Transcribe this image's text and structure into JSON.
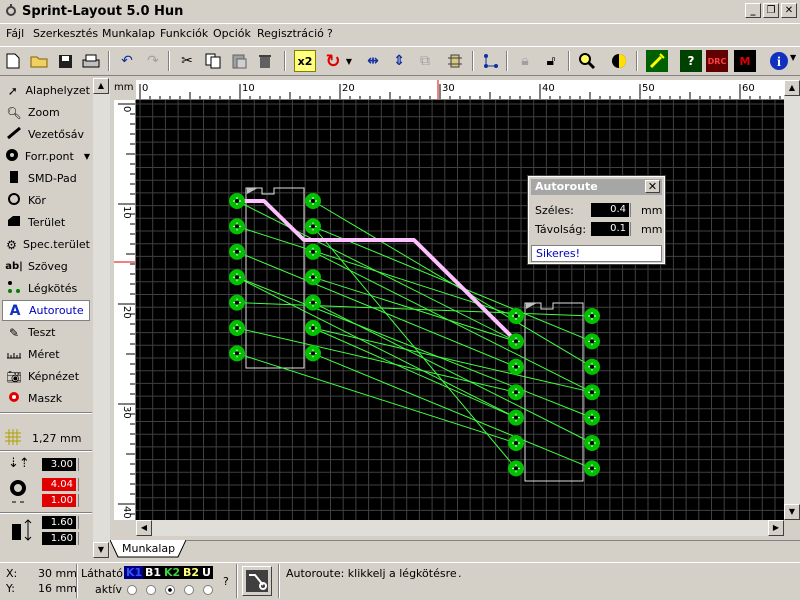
{
  "window": {
    "title": "Sprint-Layout 5.0 Hun"
  },
  "menu": [
    "Fájl",
    "Szerkesztés",
    "Munkalap",
    "Funkciók",
    "Opciók",
    "Regisztráció",
    "?"
  ],
  "toolbar": {
    "zoom_x2": "x2",
    "drc_label": "DRC"
  },
  "tools": [
    {
      "label": "Alaphelyzet",
      "icon": "pointer-icon"
    },
    {
      "label": "Zoom",
      "icon": "magnifier-icon"
    },
    {
      "label": "Vezetősáv",
      "icon": "track-icon"
    },
    {
      "label": "Forr.pont",
      "icon": "pad-icon"
    },
    {
      "label": "SMD-Pad",
      "icon": "smd-pad-icon"
    },
    {
      "label": "Kör",
      "icon": "circle-icon"
    },
    {
      "label": "Terület",
      "icon": "area-icon"
    },
    {
      "label": "Spec.terület",
      "icon": "special-area-icon"
    },
    {
      "label": "Szöveg",
      "icon": "text-icon"
    },
    {
      "label": "Légkötés",
      "icon": "airwire-icon"
    },
    {
      "label": "Autoroute",
      "icon": "autoroute-icon",
      "active": true
    },
    {
      "label": "Teszt",
      "icon": "test-icon"
    },
    {
      "label": "Méret",
      "icon": "ruler-icon"
    },
    {
      "label": "Képnézet",
      "icon": "camera-icon"
    },
    {
      "label": "Maszk",
      "icon": "mask-icon"
    }
  ],
  "grid": {
    "label": "1,27 mm"
  },
  "settings": {
    "track_width": "3.00",
    "pad_outer": "4.04",
    "pad_inner": "1.00",
    "smd_width": "1.60",
    "smd_height": "1.60"
  },
  "ruler": {
    "unit": "mm",
    "h_ticks": [
      "0",
      "10",
      "20",
      "30",
      "40",
      "50",
      "60"
    ],
    "v_ticks": [
      "0",
      "10",
      "20",
      "30",
      "40"
    ]
  },
  "autoroute_dialog": {
    "title": "Autoroute",
    "width_label": "Széles:",
    "width_value": "0.4",
    "width_unit": "mm",
    "distance_label": "Távolság:",
    "distance_value": "0.1",
    "distance_unit": "mm",
    "status": "Sikeres!"
  },
  "tabs": {
    "sheet": "Munkalap"
  },
  "status": {
    "x_label": "X:",
    "x_value": "30 mm",
    "y_label": "Y:",
    "y_value": "16 mm",
    "visible_label": "Látható",
    "active_label": "aktív",
    "layers": [
      {
        "name": "K1",
        "color": "#3050ff",
        "bg": "#000080"
      },
      {
        "name": "B1",
        "color": "#ffffff",
        "bg": "#000000"
      },
      {
        "name": "K2",
        "color": "#40d040",
        "bg": "#000000"
      },
      {
        "name": "B2",
        "color": "#ffff80",
        "bg": "#000000"
      },
      {
        "name": "U",
        "color": "#ffffff",
        "bg": "#000000"
      }
    ],
    "help": "?",
    "message": "Autoroute: klikkelj a légkötésre"
  },
  "colors": {
    "background": "#000000",
    "pad": "#00c000",
    "airwire": "#40ff40",
    "track": "#ffc0ff",
    "grid": "#404040"
  }
}
